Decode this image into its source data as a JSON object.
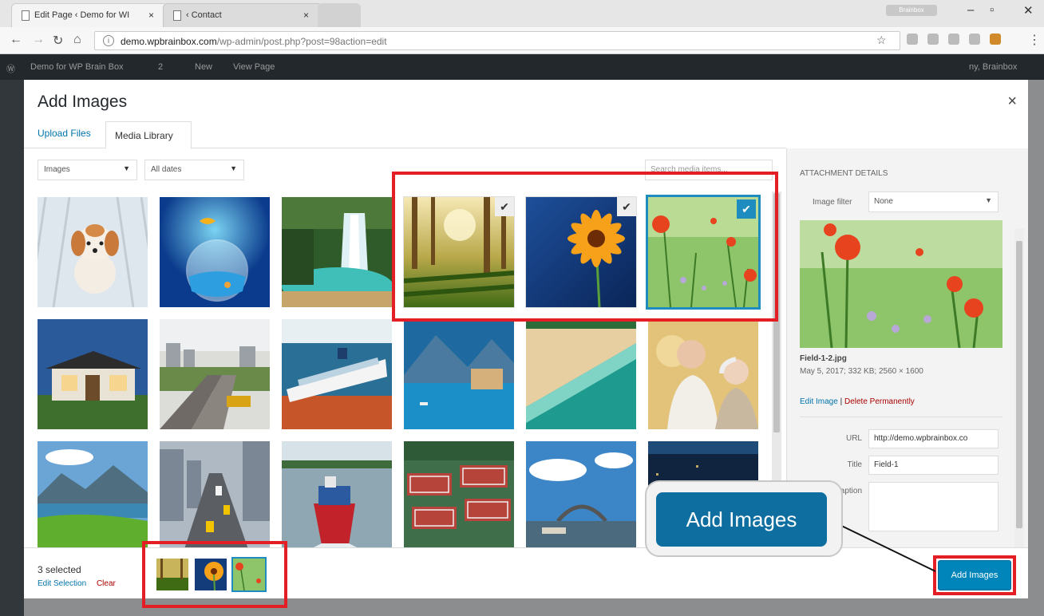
{
  "browser": {
    "tabs": [
      {
        "title": "Edit Page ‹ Demo for WI",
        "close": "×"
      },
      {
        "title": "‹ Contact",
        "close": "×"
      }
    ],
    "profile_label": "Brainbox",
    "url_host": "demo.wpbrainbox.com",
    "url_path": "/wp-admin/post.php?post=98action=edit"
  },
  "admin_bar": {
    "site_name": "Demo for WP Brain Box",
    "comments": "2",
    "new_label": "New",
    "view_label": "View Page",
    "user": "ny, Brainbox"
  },
  "modal": {
    "title": "Add Images",
    "close_label": "×",
    "tabs": [
      "Upload Files",
      "Media Library"
    ],
    "filters": {
      "type": "Images",
      "date": "All dates"
    },
    "search_placeholder": "Search media items..."
  },
  "media_grid": [
    {
      "name": "puppy-icon",
      "selected": false
    },
    {
      "name": "fishbowl-icon",
      "selected": false
    },
    {
      "name": "waterfall-icon",
      "selected": false
    },
    {
      "name": "forest-icon",
      "selected": true,
      "active": false
    },
    {
      "name": "gerbera-icon",
      "selected": true,
      "active": false
    },
    {
      "name": "field-flowers-icon",
      "selected": true,
      "active": true
    },
    {
      "name": "house-icon",
      "selected": false
    },
    {
      "name": "railway-icon",
      "selected": false
    },
    {
      "name": "cruise-ship-icon",
      "selected": false
    },
    {
      "name": "lake-town-icon",
      "selected": false
    },
    {
      "name": "beach-icon",
      "selected": false
    },
    {
      "name": "elderly-couple-icon",
      "selected": false
    },
    {
      "name": "mountain-lake-icon",
      "selected": false
    },
    {
      "name": "city-street-icon",
      "selected": false
    },
    {
      "name": "cargo-ship-icon",
      "selected": false
    },
    {
      "name": "tennis-courts-icon",
      "selected": false
    },
    {
      "name": "sydney-harbour-icon",
      "selected": false
    },
    {
      "name": "city-night-icon",
      "selected": false
    }
  ],
  "attachment": {
    "heading": "ATTACHMENT DETAILS",
    "image_filter_label": "Image filter",
    "image_filter_value": "None",
    "filename": "Field-1-2.jpg",
    "meta": "May 5, 2017; 332 KB; 2560 × 1600",
    "edit_link": "Edit Image",
    "separator": "|",
    "delete_link": "Delete Permanently",
    "url_label": "URL",
    "url_value": "http://demo.wpbrainbox.co",
    "title_label": "Title",
    "title_value": "Field-1",
    "caption_label": "Caption"
  },
  "toolbar": {
    "selected_count": "3 selected",
    "edit_selection": "Edit Selection",
    "clear": "Clear",
    "add_button": "Add Images"
  },
  "callout": {
    "label": "Add Images"
  },
  "colors": {
    "accent": "#0085ba",
    "highlight": "#e31e24",
    "selection": "#1e8cbe"
  }
}
